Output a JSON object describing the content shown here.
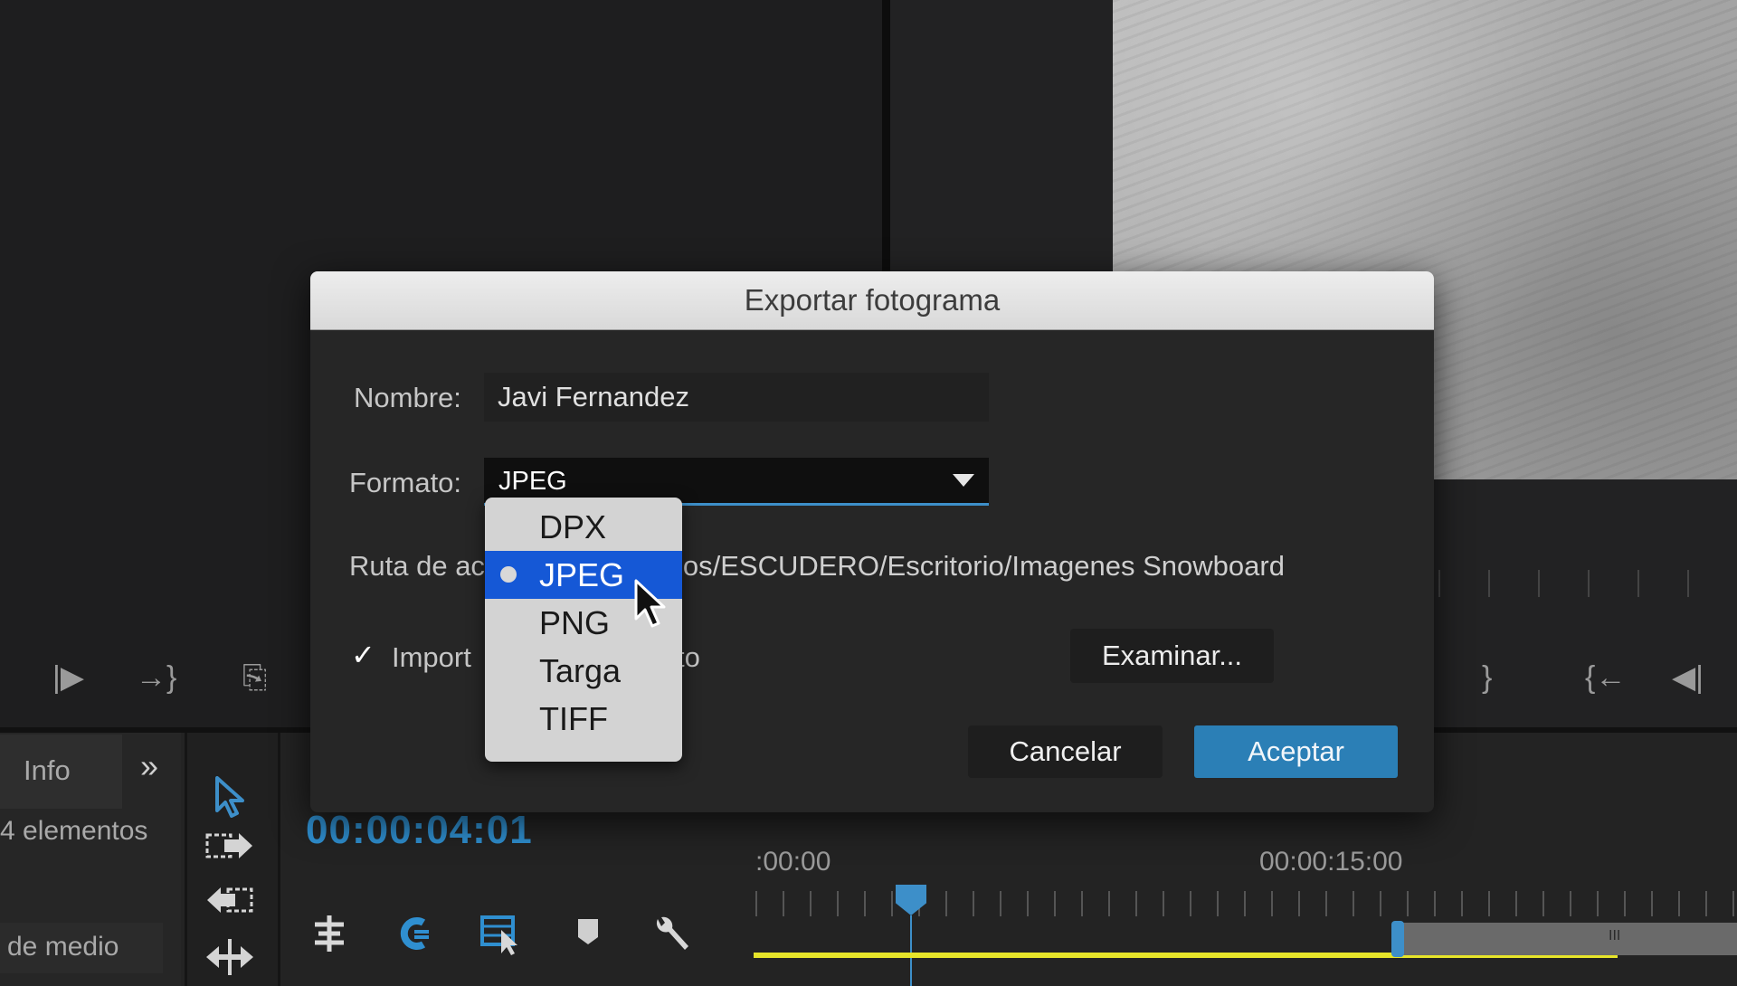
{
  "program_controls": {
    "brace": "}",
    "go_in": "{←",
    "step_back": "◀|"
  },
  "source_controls": {
    "play_out": "|▶",
    "insert": "→}",
    "export": "⎘"
  },
  "info_panel": {
    "tab_label": "Info",
    "expand": "»",
    "items_count": "4 elementos",
    "media_label": "de medio"
  },
  "timeline": {
    "timecode": "00:00:04:01",
    "ruler_start": ":00:00",
    "ruler_mid": "00:00:15:00",
    "scroll_grip": "III"
  },
  "dialog": {
    "title": "Exportar fotograma",
    "name_label": "Nombre:",
    "name_value": "Javi Fernandez",
    "format_label": "Formato:",
    "format_value": "JPEG",
    "path_label": "Ruta de ac",
    "path_value": "ios/ESCUDERO/Escritorio/Imagenes Snowboard",
    "import_label": "Import",
    "import_label_tail": "to",
    "import_checked": "✓",
    "browse_label": "Examinar...",
    "cancel_label": "Cancelar",
    "accept_label": "Aceptar"
  },
  "format_menu": {
    "items": [
      "DPX",
      "JPEG",
      "PNG",
      "Targa",
      "TIFF"
    ],
    "selected": "JPEG"
  },
  "icons": {
    "selection-tool": "arrow-cursor-icon",
    "track-select-forward": "track-select-icon",
    "ripple-edit": "ripple-edit-icon",
    "slip-tool": "slip-icon",
    "snap": "snap-icon",
    "linked-selection": "linked-selection-icon",
    "add-marker": "marker-icon",
    "settings": "wrench-icon"
  },
  "colors": {
    "accent": "#2b7fb6",
    "menu_highlight": "#1558d6",
    "timecode": "#2f8fd0",
    "work_area": "#e6e42a"
  }
}
